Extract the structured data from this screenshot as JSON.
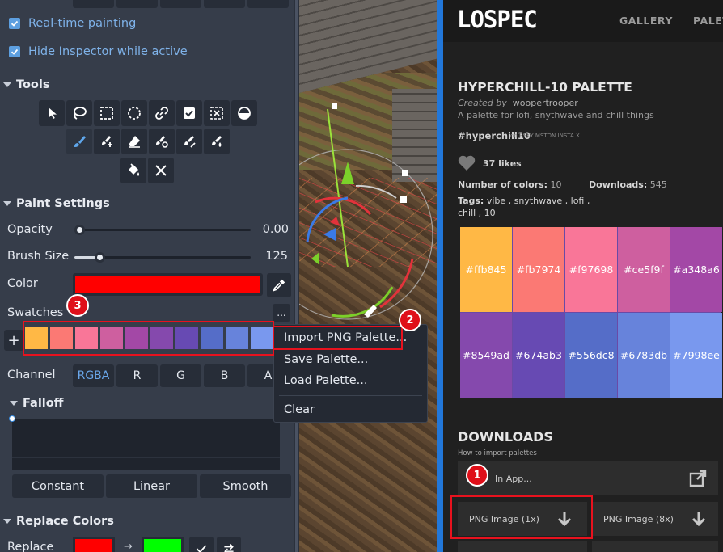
{
  "inspector": {
    "checkboxes": [
      {
        "label": "Real-time painting",
        "checked": true
      },
      {
        "label": "Hide Inspector while active",
        "checked": true
      }
    ],
    "sections": {
      "tools": "Tools",
      "paint_settings": "Paint Settings",
      "falloff": "Falloff",
      "replace_colors": "Replace Colors"
    },
    "tools_row1": [
      "pointer-icon",
      "lasso-icon",
      "rect-select-icon",
      "circle-select-icon",
      "link-icon",
      "check-icon",
      "select-x-icon",
      "hemisphere-icon"
    ],
    "tools_row2": [
      "brush-icon",
      "brush-add-icon",
      "eraser-icon",
      "brush-target-icon",
      "brush-slash-icon",
      "brush-drop-icon"
    ],
    "tools_row3": [
      "fill-bucket-icon",
      "close-icon"
    ],
    "opacity": {
      "label": "Opacity",
      "value": "0.00",
      "level": 0.0
    },
    "brush_size": {
      "label": "Brush Size",
      "value": "125",
      "level": 0.12
    },
    "color": {
      "label": "Color",
      "value": "#ff0000"
    },
    "swatches": {
      "label": "Swatches",
      "more_label": "...",
      "add_label": "+",
      "colors": [
        "#ffb845",
        "#fb7974",
        "#f97698",
        "#ce5f9f",
        "#a348a6",
        "#8549ad",
        "#674ab3",
        "#556dc8",
        "#6783db",
        "#7998ee"
      ]
    },
    "channel": {
      "label": "Channel",
      "options": [
        "RGBA",
        "R",
        "G",
        "B",
        "A"
      ],
      "selected": "RGBA"
    },
    "falloff_modes": [
      "Constant",
      "Linear",
      "Smooth"
    ],
    "replace": {
      "label": "Replace",
      "from": "#ff0000",
      "to": "#00ff00",
      "arrow": "→"
    }
  },
  "context_menu": {
    "items": [
      "Import PNG Palette...",
      "Save Palette...",
      "Load Palette...",
      "Clear"
    ]
  },
  "lospec": {
    "logo": "LOSPEC",
    "nav": [
      "GALLERY",
      "PALET"
    ],
    "title": "HYPERCHILL-10 PALETTE",
    "created_by_prefix": "Created by",
    "author": "woopertrooper",
    "description": "A palette for lofi, snythwave and chill things",
    "hashtag": "#hyperchill10",
    "socials": "on BSKY MSTDN INSTA X",
    "likes": "37 likes",
    "num_colors_label": "Number of colors:",
    "num_colors": "10",
    "downloads_label": "Downloads:",
    "downloads_count": "545",
    "tags_label": "Tags:",
    "tags_line1": "vibe , snythwave , lofi ,",
    "tags_line2": "chill , 10",
    "palette": [
      {
        "hex": "#ffb845",
        "text": "#ffb845"
      },
      {
        "hex": "#fb7974",
        "text": "#fb7974"
      },
      {
        "hex": "#f97698",
        "text": "#f97698"
      },
      {
        "hex": "#ce5f9f",
        "text": "#ce5f9f"
      },
      {
        "hex": "#a348a6",
        "text": "#a348a6"
      },
      {
        "hex": "#8549ad",
        "text": "#8549ad"
      },
      {
        "hex": "#674ab3",
        "text": "#674ab3"
      },
      {
        "hex": "#556dc8",
        "text": "#556dc8"
      },
      {
        "hex": "#6783db",
        "text": "#6783db"
      },
      {
        "hex": "#7998ee",
        "text": "#7998ee"
      }
    ],
    "downloads_heading": "DOWNLOADS",
    "how_to": "How to import palettes",
    "open_in_app": "In App...",
    "png_1x": "PNG Image (1x)",
    "png_8x": "PNG Image (8x)"
  },
  "annotations": {
    "badge1": "1",
    "badge2": "2",
    "badge3": "3",
    "highlight_color": "#e8121e"
  }
}
